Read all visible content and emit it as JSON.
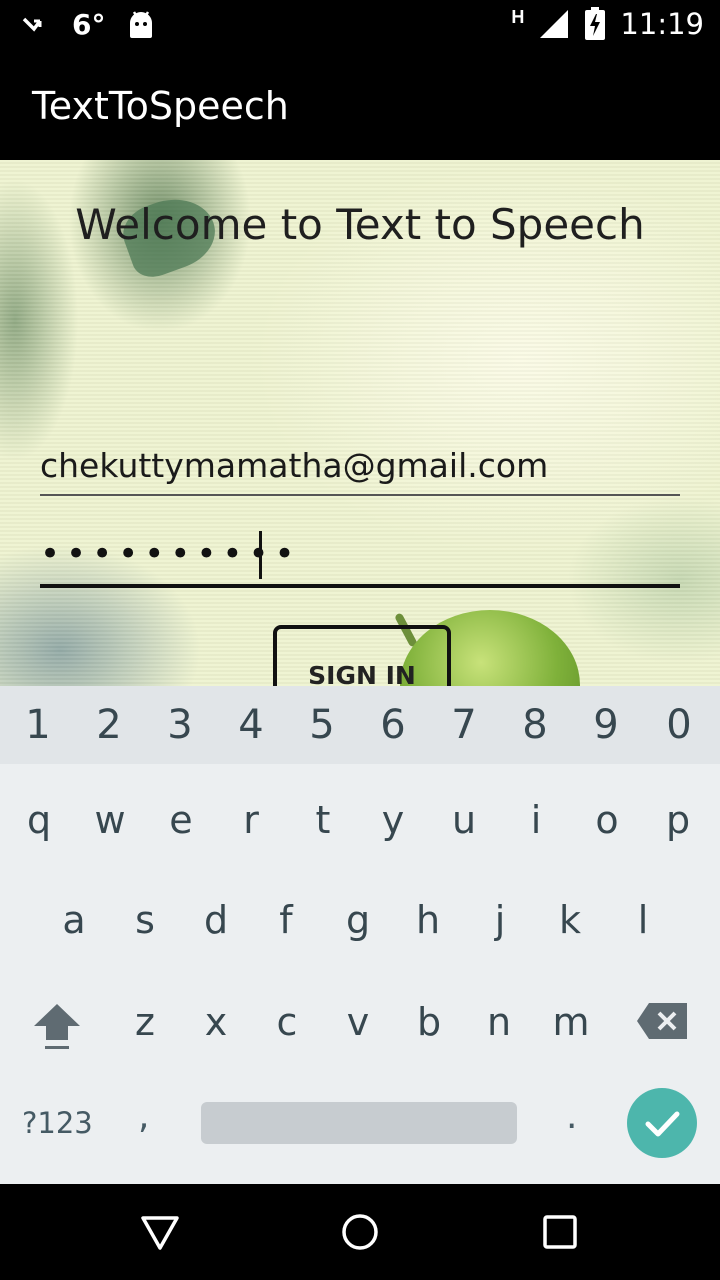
{
  "status_bar": {
    "notification_icon": "missed-call-icon",
    "temperature": "6°",
    "android_icon": "android-icon",
    "network_type": "H",
    "signal_icon": "signal-icon",
    "battery_icon": "battery-charging-icon",
    "time": "11:19"
  },
  "app_bar": {
    "title": "TextToSpeech"
  },
  "main": {
    "welcome_text": "Welcome to Text to Speech",
    "email_value": "chekuttymamatha@gmail.com",
    "password_masked": "••••••••••",
    "signin_label": "SIGN IN"
  },
  "keyboard": {
    "number_row": [
      "1",
      "2",
      "3",
      "4",
      "5",
      "6",
      "7",
      "8",
      "9",
      "0"
    ],
    "row1": [
      "q",
      "w",
      "e",
      "r",
      "t",
      "y",
      "u",
      "i",
      "o",
      "p"
    ],
    "row2": [
      "a",
      "s",
      "d",
      "f",
      "g",
      "h",
      "j",
      "k",
      "l"
    ],
    "row3": [
      "z",
      "x",
      "c",
      "v",
      "b",
      "n",
      "m"
    ],
    "symbols_label": "?123",
    "comma": ",",
    "period": ".",
    "accent_color": "#4db6ac"
  },
  "nav_bar": {
    "icons": [
      "back-icon",
      "home-icon",
      "recents-icon"
    ]
  }
}
